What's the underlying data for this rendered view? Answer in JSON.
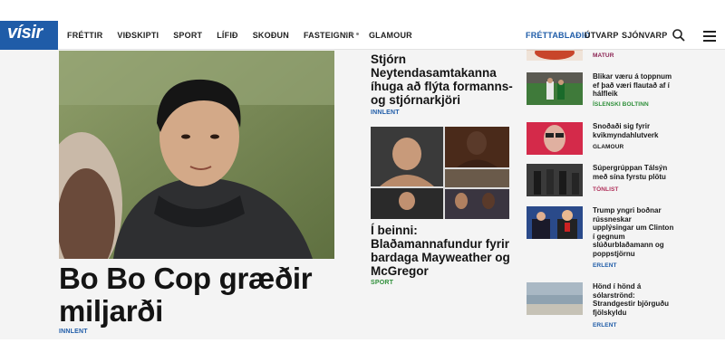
{
  "header": {
    "logo": "vísir",
    "nav": [
      "FRÉTTIR",
      "VIÐSKIPTI",
      "SPORT",
      "LÍFIÐ",
      "SKOÐUN",
      "FASTEIGNIR",
      "GLAMOUR"
    ],
    "nav_right": [
      "FRÉTTABLAÐIÐ",
      "ÚTVARP",
      "SJÓNVARP"
    ]
  },
  "main": {
    "headline": "Bo Bo Cop græðir miljarði",
    "headline_tag": "INNLENT"
  },
  "middle": {
    "story1_title": "Stjórn Neytendasamtakanna íhuga að flýta formanns- og stjórnarkjöri",
    "story1_tag": "INNLENT",
    "story2_title": "Í beinni: Blaðamannafundur fyrir bardaga Mayweather og McGregor",
    "story2_tag": "SPORT"
  },
  "sidebar": {
    "items": [
      {
        "title": "",
        "tag": "MATUR"
      },
      {
        "title": "Blikar væru á toppnum ef það væri flautað af í hálfleik",
        "tag": "ÍSLENSKI BOLTINN"
      },
      {
        "title": "Snoðaði sig fyrir kvikmyndahlutverk",
        "tag": "GLAMOUR"
      },
      {
        "title": "Súpergrúppan Tálsýn með sína fyrstu plötu",
        "tag": "TÓNLIST"
      },
      {
        "title": "Trump yngri boðnar rússneskar upplýsingar um Clinton í gegnum slúðurblaðamann og poppstjörnu",
        "tag": "ERLENT"
      },
      {
        "title": "Hönd í hönd á sólarströnd: Strandgestir björguðu fjölskyldu",
        "tag": "ERLENT"
      }
    ]
  },
  "colors": {
    "brand": "#1f5ca8",
    "sport": "#2f8f3a",
    "matur": "#8b2252"
  }
}
